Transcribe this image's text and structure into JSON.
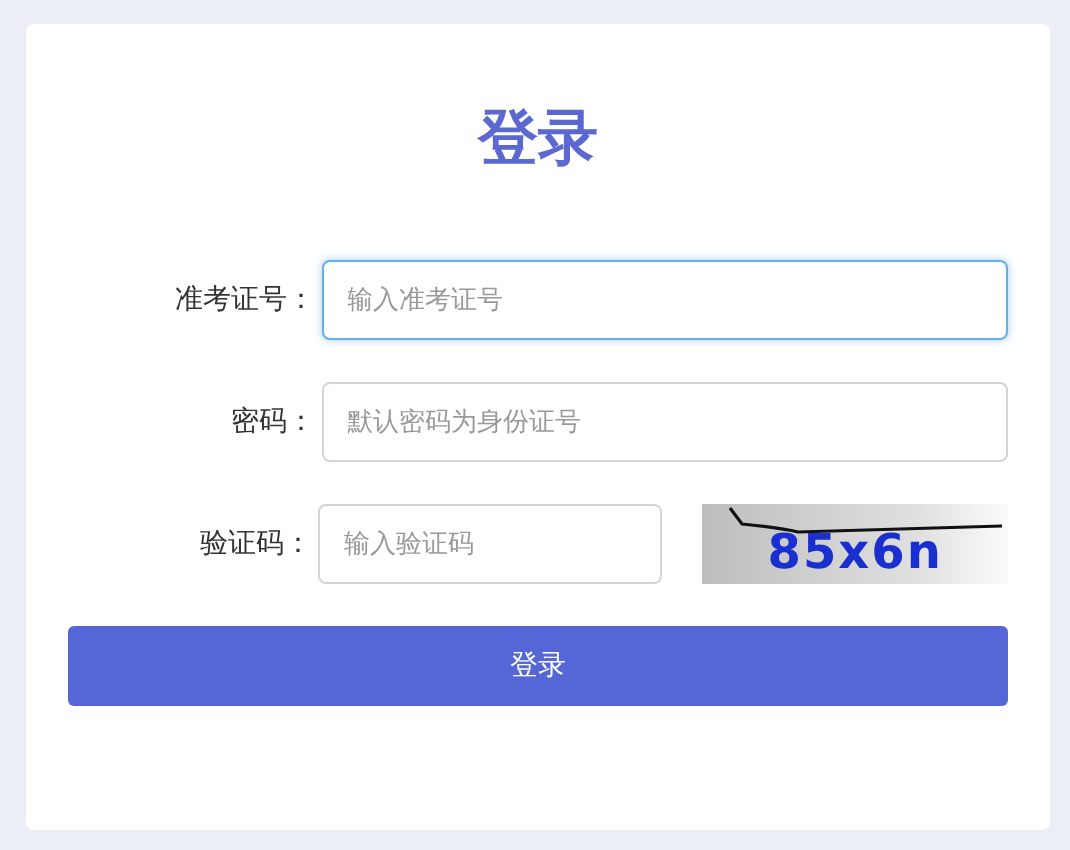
{
  "title": "登录",
  "fields": [
    {
      "label": "准考证号：",
      "placeholder": "输入准考证号",
      "kind": "text",
      "focused": true
    },
    {
      "label": "密码：",
      "placeholder": "默认密码为身份证号",
      "kind": "text",
      "focused": false
    },
    {
      "label": "验证码：",
      "placeholder": "输入验证码",
      "kind": "captcha",
      "focused": false,
      "captcha_code": "85x6n"
    }
  ],
  "submit_button": "登录"
}
